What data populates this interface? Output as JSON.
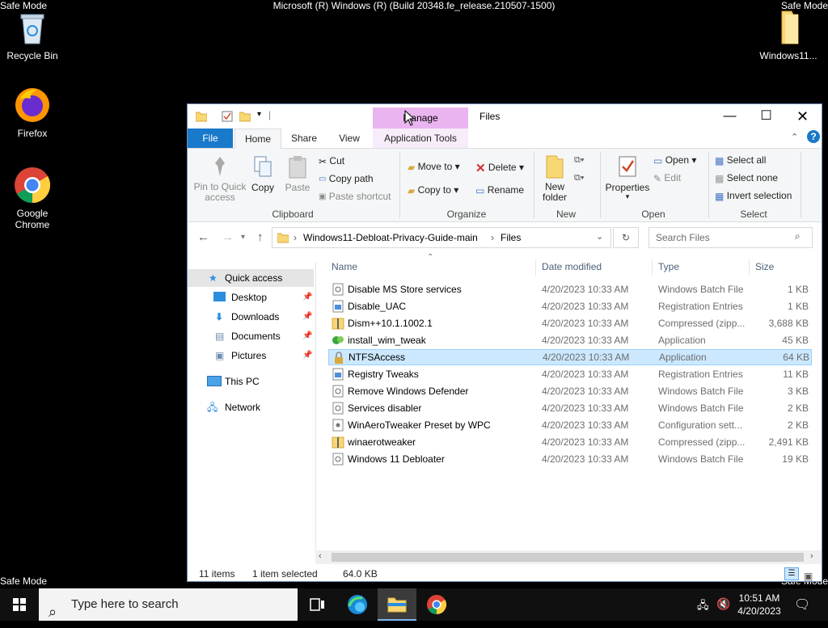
{
  "desktop": {
    "safe_mode_tl": "Safe Mode",
    "safe_mode_tr": "Safe Mode",
    "safe_mode_bl": "Safe Mode",
    "safe_mode_br": "Safe Mode",
    "build": "Microsoft (R) Windows (R) (Build 20348.fe_release.210507-1500)",
    "icons": {
      "recycle": "Recycle Bin",
      "firefox": "Firefox",
      "chrome": "Google Chrome",
      "folder": "Windows11..."
    }
  },
  "window": {
    "ctx_tab": "Manage",
    "title": "Files",
    "tabs": {
      "file": "File",
      "home": "Home",
      "share": "Share",
      "view": "View",
      "app_tools": "Application Tools"
    },
    "ribbon": {
      "clipboard": {
        "pin": "Pin to Quick access",
        "copy": "Copy",
        "paste": "Paste",
        "cut": "Cut",
        "copy_path": "Copy path",
        "paste_shortcut": "Paste shortcut",
        "label": "Clipboard"
      },
      "organize": {
        "move_to": "Move to",
        "copy_to": "Copy to",
        "delete": "Delete",
        "rename": "Rename",
        "label": "Organize"
      },
      "new": {
        "new_folder": "New folder",
        "label": "New"
      },
      "open": {
        "properties": "Properties",
        "open": "Open",
        "edit": "Edit",
        "label": "Open"
      },
      "select": {
        "select_all": "Select all",
        "select_none": "Select none",
        "invert": "Invert selection",
        "label": "Select"
      }
    },
    "address": {
      "crumb1": "Windows11-Debloat-Privacy-Guide-main",
      "crumb2": "Files"
    },
    "search_placeholder": "Search Files",
    "nav": {
      "quick_access": "Quick access",
      "desktop": "Desktop",
      "downloads": "Downloads",
      "documents": "Documents",
      "pictures": "Pictures",
      "this_pc": "This PC",
      "network": "Network"
    },
    "columns": {
      "name": "Name",
      "date": "Date modified",
      "type": "Type",
      "size": "Size"
    },
    "files": [
      {
        "name": "Disable MS Store services",
        "date": "4/20/2023 10:33 AM",
        "type": "Windows Batch File",
        "size": "1 KB",
        "icon": "batch-file-icon"
      },
      {
        "name": "Disable_UAC",
        "date": "4/20/2023 10:33 AM",
        "type": "Registration Entries",
        "size": "1 KB",
        "icon": "registry-file-icon"
      },
      {
        "name": "Dism++10.1.1002.1",
        "date": "4/20/2023 10:33 AM",
        "type": "Compressed (zipp...",
        "size": "3,688 KB",
        "icon": "zip-folder-icon"
      },
      {
        "name": "install_wim_tweak",
        "date": "4/20/2023 10:33 AM",
        "type": "Application",
        "size": "45 KB",
        "icon": "application-icon"
      },
      {
        "name": "NTFSAccess",
        "date": "4/20/2023 10:33 AM",
        "type": "Application",
        "size": "64 KB",
        "icon": "lock-app-icon"
      },
      {
        "name": "Registry Tweaks",
        "date": "4/20/2023 10:33 AM",
        "type": "Registration Entries",
        "size": "11 KB",
        "icon": "registry-file-icon"
      },
      {
        "name": "Remove Windows Defender",
        "date": "4/20/2023 10:33 AM",
        "type": "Windows Batch File",
        "size": "3 KB",
        "icon": "batch-file-icon"
      },
      {
        "name": "Services disabler",
        "date": "4/20/2023 10:33 AM",
        "type": "Windows Batch File",
        "size": "2 KB",
        "icon": "batch-file-icon"
      },
      {
        "name": "WinAeroTweaker Preset by WPC",
        "date": "4/20/2023 10:33 AM",
        "type": "Configuration sett...",
        "size": "2 KB",
        "icon": "config-file-icon"
      },
      {
        "name": "winaerotweaker",
        "date": "4/20/2023 10:33 AM",
        "type": "Compressed (zipp...",
        "size": "2,491 KB",
        "icon": "zip-folder-icon"
      },
      {
        "name": "Windows 11 Debloater",
        "date": "4/20/2023 10:33 AM",
        "type": "Windows Batch File",
        "size": "19 KB",
        "icon": "batch-file-icon"
      }
    ],
    "status": {
      "count": "11 items",
      "selected": "1 item selected",
      "size": "64.0 KB"
    }
  },
  "taskbar": {
    "search_placeholder": "Type here to search",
    "time": "10:51 AM",
    "date": "4/20/2023"
  },
  "colors": {
    "accent": "#1979ca",
    "selection": "#cce8ff",
    "manage_tab": "#e9b4f0"
  }
}
